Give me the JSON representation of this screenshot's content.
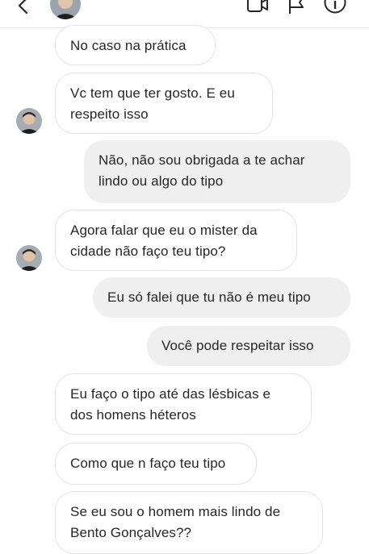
{
  "header": {
    "back_icon": "back-chevron-icon",
    "video_icon": "video-camera-icon",
    "flag_icon": "flag-icon",
    "info_icon": "info-icon"
  },
  "messages": [
    {
      "side": "in",
      "lines": [
        "No caso na prática"
      ]
    },
    {
      "side": "in",
      "lines": [
        "Vc tem que ter gosto. E eu",
        "respeito isso"
      ],
      "avatar": true
    },
    {
      "side": "out",
      "lines": [
        "Não, não sou obrigada a te achar",
        "lindo ou algo do tipo"
      ]
    },
    {
      "side": "in",
      "lines": [
        "Agora falar que eu o mister da",
        "cidade  não faço teu tipo?"
      ],
      "avatar": true
    },
    {
      "side": "out",
      "lines": [
        "Eu só falei que tu não é meu tipo"
      ]
    },
    {
      "side": "out",
      "lines": [
        "Você pode respeitar isso"
      ]
    },
    {
      "side": "in",
      "lines": [
        "Eu faço o tipo até das lésbicas e",
        "dos homens héteros"
      ]
    },
    {
      "side": "in",
      "lines": [
        "Como que n faço teu tipo"
      ]
    },
    {
      "side": "in",
      "lines": [
        "Se eu sou o homem mais lindo de",
        "Bento Gonçalves??"
      ]
    }
  ],
  "colors": {
    "incoming_bg": "#ffffff",
    "outgoing_bg": "#efefef",
    "text": "#262626"
  }
}
